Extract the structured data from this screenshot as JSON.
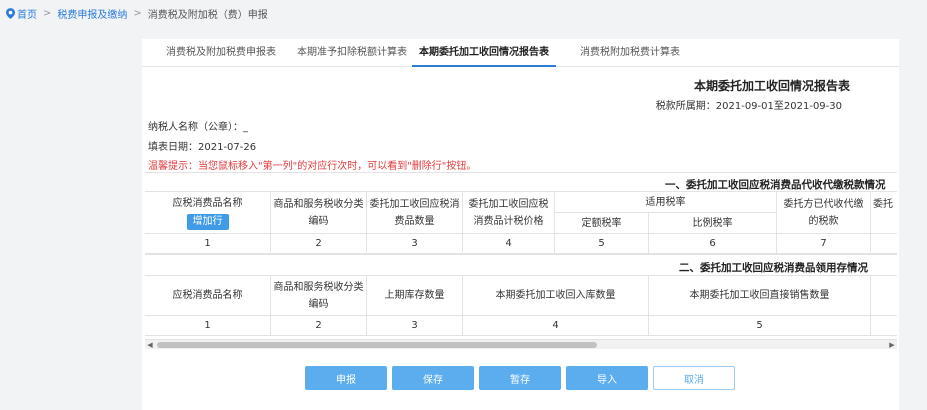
{
  "breadcrumb": {
    "home": "首页",
    "level1": "税费申报及缴纳",
    "current": "消费税及附加税（费）申报",
    "separator": ">"
  },
  "tabs": [
    {
      "label": "消费税及附加税费申报表",
      "active": false
    },
    {
      "label": "本期准予扣除税额计算表",
      "active": false
    },
    {
      "label": "本期委托加工收回情况报告表",
      "active": true
    },
    {
      "label": "消费税附加税费计算表",
      "active": false
    }
  ],
  "report": {
    "title": "本期委托加工收回情况报告表",
    "period": "税款所属期：2021-09-01至2021-09-30",
    "taxpayer": "纳税人名称（公章）：_",
    "fill_date": "填表日期：2021-07-26",
    "hint": "温馨提示：当您鼠标移入\"第一列\"的对应行次时，可以看到\"删除行\"按钮。"
  },
  "section1": {
    "title": "一、委托加工收回应税消费品代收代缴税款情况",
    "add_row": "增加行",
    "headers": {
      "c1": "应税消费品名称",
      "c2": "商品和服务税收分类编码",
      "c3": "委托加工收回应税消费品数量",
      "c4": "委托加工收回应税消费品计税价格",
      "rate": "适用税率",
      "c5": "定额税率",
      "c6": "比例税率",
      "c7": "委托方已代收代缴的税款",
      "c8": "委托"
    },
    "nums": [
      "1",
      "2",
      "3",
      "4",
      "5",
      "6",
      "7"
    ]
  },
  "section2": {
    "title": "二、委托加工收回应税消费品领用存情况",
    "headers": {
      "c1": "应税消费品名称",
      "c2": "商品和服务税收分类编码",
      "c3": "上期库存数量",
      "c4": "本期委托加工收回入库数量",
      "c5": "本期委托加工收回直接销售数量"
    },
    "nums": [
      "1",
      "2",
      "3",
      "4",
      "5"
    ]
  },
  "buttons": {
    "declare": "申报",
    "save": "保存",
    "draft": "暂存",
    "import": "导入",
    "cancel": "取消"
  },
  "colors": {
    "primary": "#5cadee",
    "link": "#2b7bd9",
    "warning": "#e4393c"
  }
}
